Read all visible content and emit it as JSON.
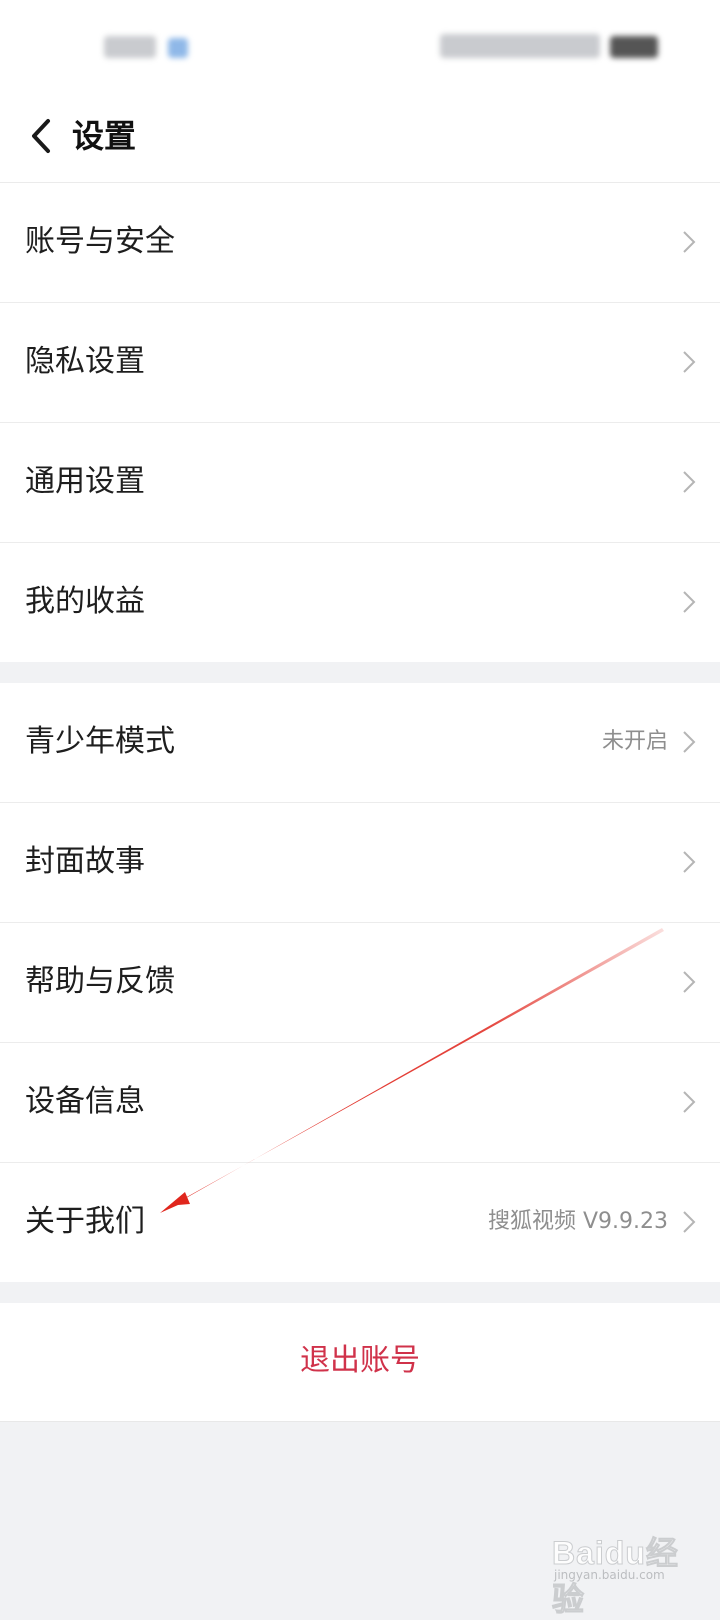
{
  "header": {
    "title": "设置"
  },
  "settings_group_1": [
    {
      "label": "账号与安全",
      "value": ""
    },
    {
      "label": "隐私设置",
      "value": ""
    },
    {
      "label": "通用设置",
      "value": ""
    },
    {
      "label": "我的收益",
      "value": ""
    }
  ],
  "settings_group_2": [
    {
      "label": "青少年模式",
      "value": "未开启"
    },
    {
      "label": "封面故事",
      "value": ""
    },
    {
      "label": "帮助与反馈",
      "value": ""
    },
    {
      "label": "设备信息",
      "value": ""
    },
    {
      "label": "关于我们",
      "value": "搜狐视频 V9.9.23"
    }
  ],
  "logout": {
    "label": "退出账号"
  },
  "watermark": {
    "logo": "Baidu经验",
    "sub": "jingyan.baidu.com"
  },
  "colors": {
    "logout": "#d0324a",
    "annotation_arrow": "#e0261d",
    "background": "#f1f2f4"
  }
}
